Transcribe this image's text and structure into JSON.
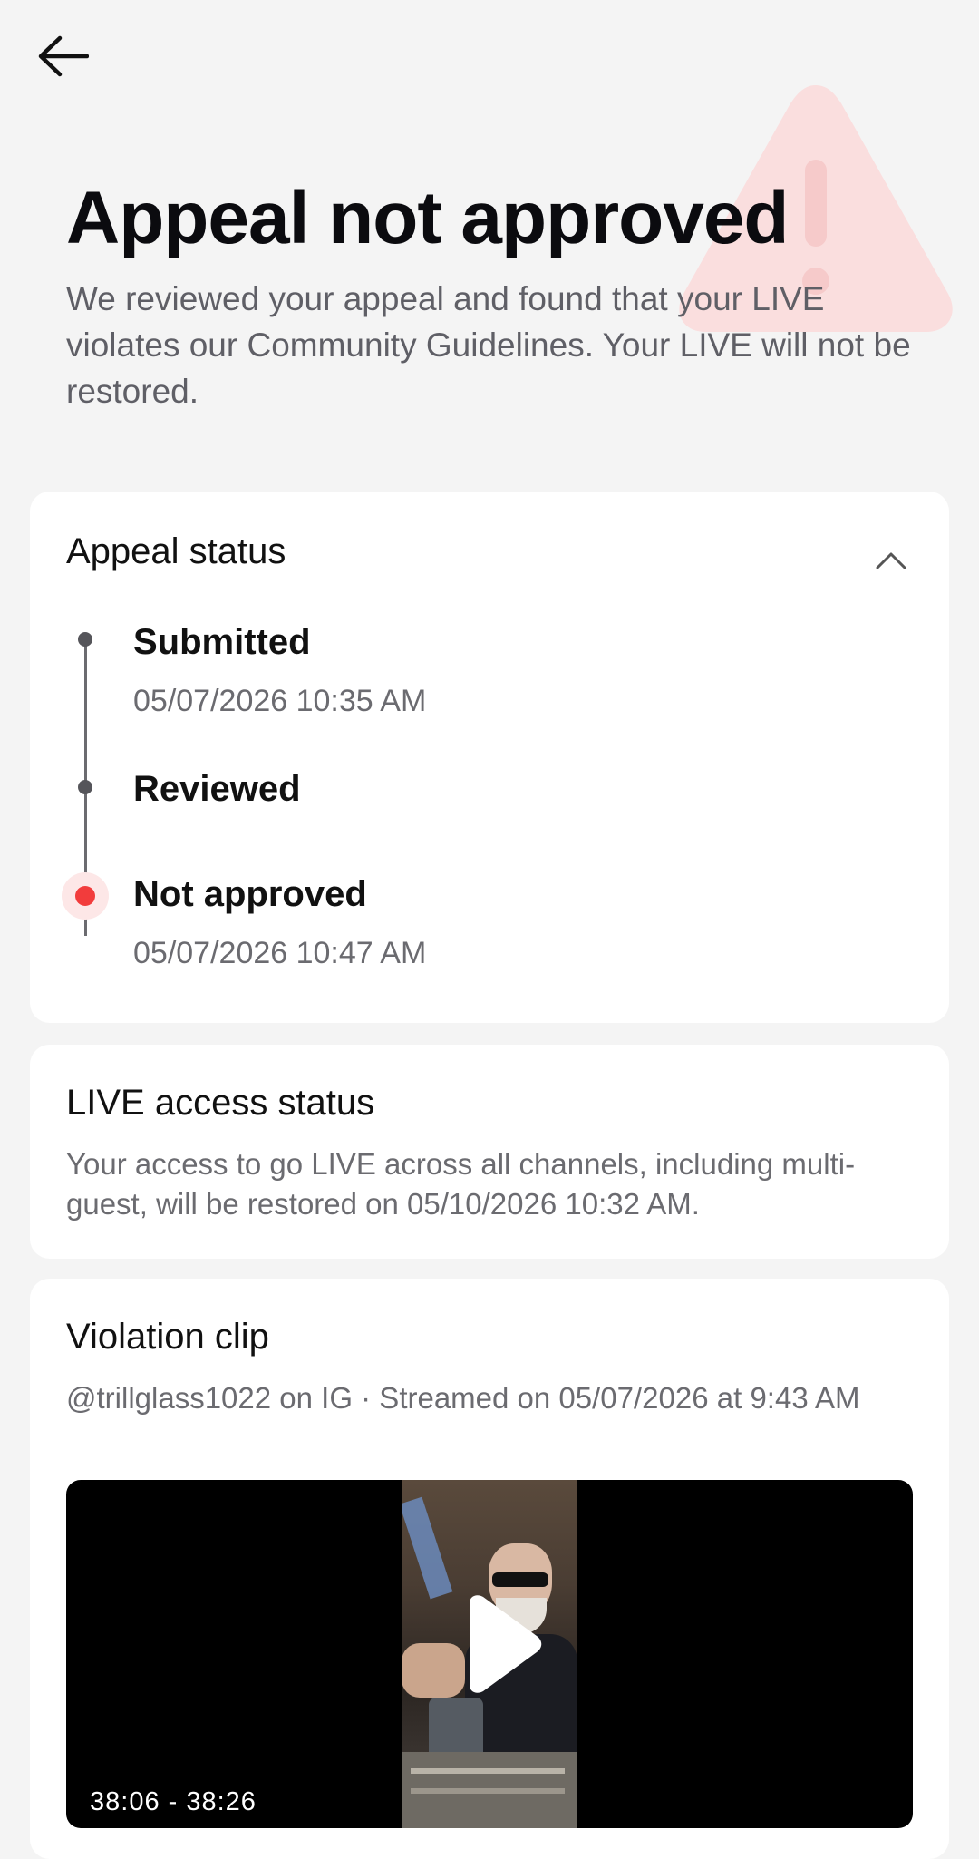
{
  "header": {
    "back_icon": "arrow-left-icon",
    "background_icon": "warning-triangle-icon"
  },
  "page": {
    "title": "Appeal not approved",
    "subtitle": "We reviewed your appeal and found that your LIVE violates our Community Guidelines. Your LIVE will not be restored."
  },
  "appeal_status": {
    "title": "Appeal status",
    "toggle_icon": "chevron-up-icon",
    "steps": [
      {
        "label": "Submitted",
        "time": "05/07/2026 10:35 AM",
        "state": "done"
      },
      {
        "label": "Reviewed",
        "time": "",
        "state": "done"
      },
      {
        "label": "Not approved",
        "time": "05/07/2026 10:47 AM",
        "state": "rejected"
      }
    ]
  },
  "live_access": {
    "title": "LIVE access status",
    "text": "Your access to go LIVE across all channels, including multi-guest, will be restored on 05/10/2026 10:32 AM."
  },
  "violation_clip": {
    "title": "Violation clip",
    "meta": "@trillglass1022 on IG · Streamed on 05/07/2026 at 9:43 AM",
    "duration": "38:06 - 38:26",
    "play_icon": "play-icon"
  },
  "colors": {
    "background": "#f4f4f4",
    "card": "#ffffff",
    "rejected": "#f23c3c",
    "timeline": "#55555a",
    "warning_tint": "#fbdcdc"
  }
}
